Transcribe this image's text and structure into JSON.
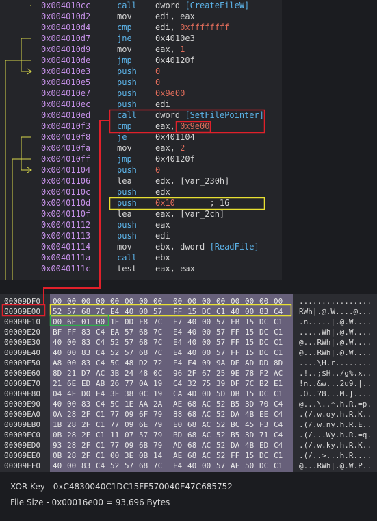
{
  "disassembly": [
    {
      "addr": "0x004010cc",
      "mn": "call",
      "mk": "call",
      "ops": [
        {
          "t": "dword ",
          "c": "br"
        },
        {
          "t": "[CreateFileW]",
          "c": "api"
        }
      ]
    },
    {
      "addr": "0x004010d2",
      "mn": "mov",
      "mk": "plain",
      "ops": [
        {
          "t": "edi, eax",
          "c": "br"
        }
      ]
    },
    {
      "addr": "0x004010d4",
      "mn": "cmp",
      "mk": "flow",
      "ops": [
        {
          "t": "edi, ",
          "c": "br"
        },
        {
          "t": "0xffffffff",
          "c": "num"
        }
      ]
    },
    {
      "addr": "0x004010d7",
      "mn": "jne",
      "mk": "flow",
      "ops": [
        {
          "t": "0x4010e3",
          "c": "br"
        }
      ]
    },
    {
      "addr": "0x004010d9",
      "mn": "mov",
      "mk": "plain",
      "ops": [
        {
          "t": "eax, ",
          "c": "br"
        },
        {
          "t": "1",
          "c": "num"
        }
      ]
    },
    {
      "addr": "0x004010de",
      "mn": "jmp",
      "mk": "flow",
      "ops": [
        {
          "t": "0x40120f",
          "c": "br"
        }
      ]
    },
    {
      "addr": "0x004010e3",
      "mn": "push",
      "mk": "flow",
      "ops": [
        {
          "t": "0",
          "c": "num"
        }
      ]
    },
    {
      "addr": "0x004010e5",
      "mn": "push",
      "mk": "flow",
      "ops": [
        {
          "t": "0",
          "c": "num"
        }
      ]
    },
    {
      "addr": "0x004010e7",
      "mn": "push",
      "mk": "flow",
      "ops": [
        {
          "t": "0x9e00",
          "c": "num"
        }
      ]
    },
    {
      "addr": "0x004010ec",
      "mn": "push",
      "mk": "flow",
      "ops": [
        {
          "t": "edi",
          "c": "br"
        }
      ]
    },
    {
      "addr": "0x004010ed",
      "mn": "call",
      "mk": "call",
      "ops": [
        {
          "t": "dword ",
          "c": "br"
        },
        {
          "t": "[SetFilePointer]",
          "c": "api"
        }
      ]
    },
    {
      "addr": "0x004010f3",
      "mn": "cmp",
      "mk": "flow",
      "ops": [
        {
          "t": "eax, ",
          "c": "br"
        },
        {
          "t": "0x9e00",
          "c": "num"
        }
      ]
    },
    {
      "addr": "0x004010f8",
      "mn": "je",
      "mk": "flow",
      "ops": [
        {
          "t": "0x401104",
          "c": "br"
        }
      ]
    },
    {
      "addr": "0x004010fa",
      "mn": "mov",
      "mk": "plain",
      "ops": [
        {
          "t": "eax, ",
          "c": "br"
        },
        {
          "t": "2",
          "c": "num"
        }
      ]
    },
    {
      "addr": "0x004010ff",
      "mn": "jmp",
      "mk": "flow",
      "ops": [
        {
          "t": "0x40120f",
          "c": "br"
        }
      ]
    },
    {
      "addr": "0x00401104",
      "mn": "push",
      "mk": "flow",
      "ops": [
        {
          "t": "0",
          "c": "num"
        }
      ]
    },
    {
      "addr": "0x00401106",
      "mn": "lea",
      "mk": "plain",
      "ops": [
        {
          "t": "edx, [var_230h]",
          "c": "br"
        }
      ]
    },
    {
      "addr": "0x0040110c",
      "mn": "push",
      "mk": "flow",
      "ops": [
        {
          "t": "edx",
          "c": "br"
        }
      ]
    },
    {
      "addr": "0x0040110d",
      "mn": "push",
      "mk": "flow",
      "ops": [
        {
          "t": "0x10",
          "c": "num"
        },
        {
          "t": "       ; 16",
          "c": "cmt"
        }
      ]
    },
    {
      "addr": "0x0040110f",
      "mn": "lea",
      "mk": "plain",
      "ops": [
        {
          "t": "eax, [var_2ch]",
          "c": "br"
        }
      ]
    },
    {
      "addr": "0x00401112",
      "mn": "push",
      "mk": "flow",
      "ops": [
        {
          "t": "eax",
          "c": "br"
        }
      ]
    },
    {
      "addr": "0x00401113",
      "mn": "push",
      "mk": "flow",
      "ops": [
        {
          "t": "edi",
          "c": "br"
        }
      ]
    },
    {
      "addr": "0x00401114",
      "mn": "mov",
      "mk": "plain",
      "ops": [
        {
          "t": "ebx, dword ",
          "c": "br"
        },
        {
          "t": "[ReadFile]",
          "c": "api"
        }
      ]
    },
    {
      "addr": "0x0040111a",
      "mn": "call",
      "mk": "call",
      "ops": [
        {
          "t": "ebx",
          "c": "br"
        }
      ]
    },
    {
      "addr": "0x0040111c",
      "mn": "test",
      "mk": "plain",
      "ops": [
        {
          "t": "eax, eax",
          "c": "br"
        }
      ]
    }
  ],
  "hexdump": [
    {
      "off": "00009DF0",
      "bytes": [
        "00",
        "00",
        "00",
        "00",
        "00",
        "00",
        "00",
        "00",
        "00",
        "00",
        "00",
        "00",
        "00",
        "00",
        "00",
        "00"
      ],
      "ascii": "................"
    },
    {
      "off": "00009E00",
      "bytes": [
        "52",
        "57",
        "68",
        "7C",
        "E4",
        "40",
        "00",
        "57",
        "FF",
        "15",
        "DC",
        "C1",
        "40",
        "00",
        "83",
        "C4"
      ],
      "ascii": "RWh|.@.W....@..."
    },
    {
      "off": "00009E10",
      "bytes": [
        "00",
        "6E",
        "01",
        "00",
        "1F",
        "0D",
        "F8",
        "7C",
        "E7",
        "40",
        "00",
        "57",
        "FB",
        "15",
        "DC",
        "C1"
      ],
      "ascii": ".n.....|.@.W...."
    },
    {
      "off": "00009E20",
      "bytes": [
        "BF",
        "FF",
        "83",
        "C4",
        "EA",
        "57",
        "68",
        "7C",
        "E4",
        "40",
        "00",
        "57",
        "FF",
        "15",
        "DC",
        "C1"
      ],
      "ascii": ".....Wh|.@.W...."
    },
    {
      "off": "00009E30",
      "bytes": [
        "40",
        "00",
        "83",
        "C4",
        "52",
        "57",
        "68",
        "7C",
        "E4",
        "40",
        "00",
        "57",
        "FF",
        "15",
        "DC",
        "C1"
      ],
      "ascii": "@...RWh|.@.W...."
    },
    {
      "off": "00009E40",
      "bytes": [
        "40",
        "00",
        "83",
        "C4",
        "52",
        "57",
        "68",
        "7C",
        "E4",
        "40",
        "00",
        "57",
        "FF",
        "15",
        "DC",
        "C1"
      ],
      "ascii": "@...RWh|.@.W...."
    },
    {
      "off": "00009E50",
      "bytes": [
        "A8",
        "00",
        "83",
        "C4",
        "5C",
        "48",
        "D2",
        "72",
        "E4",
        "F4",
        "09",
        "9A",
        "DE",
        "AD",
        "DD",
        "8D"
      ],
      "ascii": "....\\H.r........"
    },
    {
      "off": "00009E60",
      "bytes": [
        "8D",
        "21",
        "D7",
        "AC",
        "3B",
        "24",
        "48",
        "0C",
        "96",
        "2F",
        "67",
        "25",
        "9E",
        "78",
        "F2",
        "AC"
      ],
      "ascii": ".!..;$H../g%.x.."
    },
    {
      "off": "00009E70",
      "bytes": [
        "21",
        "6E",
        "ED",
        "AB",
        "26",
        "77",
        "0A",
        "19",
        "C4",
        "32",
        "75",
        "39",
        "DF",
        "7C",
        "B2",
        "E1"
      ],
      "ascii": "!n..&w...2u9.|.."
    },
    {
      "off": "00009E80",
      "bytes": [
        "04",
        "4F",
        "D0",
        "E4",
        "3F",
        "38",
        "0C",
        "19",
        "CA",
        "4D",
        "0D",
        "5D",
        "DB",
        "15",
        "DC",
        "C1"
      ],
      "ascii": ".O..?8...M.]...."
    },
    {
      "off": "00009E90",
      "bytes": [
        "40",
        "00",
        "83",
        "C4",
        "5C",
        "1E",
        "AA",
        "2A",
        "AE",
        "68",
        "AC",
        "52",
        "B5",
        "3D",
        "70",
        "C4"
      ],
      "ascii": "@...\\..*.h.R.=p."
    },
    {
      "off": "00009EA0",
      "bytes": [
        "0A",
        "28",
        "2F",
        "C1",
        "77",
        "09",
        "6F",
        "79",
        "88",
        "68",
        "AC",
        "52",
        "DA",
        "4B",
        "EE",
        "C4"
      ],
      "ascii": ".(/.w.oy.h.R.K.."
    },
    {
      "off": "00009EB0",
      "bytes": [
        "1B",
        "28",
        "2F",
        "C1",
        "77",
        "09",
        "6E",
        "79",
        "E0",
        "68",
        "AC",
        "52",
        "BC",
        "45",
        "F3",
        "C4"
      ],
      "ascii": ".(/.w.ny.h.R.E.."
    },
    {
      "off": "00009EC0",
      "bytes": [
        "0B",
        "28",
        "2F",
        "C1",
        "11",
        "07",
        "57",
        "79",
        "BD",
        "68",
        "AC",
        "52",
        "B5",
        "3D",
        "71",
        "C4"
      ],
      "ascii": ".(/...Wy.h.R.=q."
    },
    {
      "off": "00009ED0",
      "bytes": [
        "93",
        "28",
        "2F",
        "C1",
        "77",
        "09",
        "6B",
        "79",
        "AD",
        "68",
        "AC",
        "52",
        "DA",
        "4B",
        "ED",
        "C4"
      ],
      "ascii": ".(/.w.ky.h.R.K.."
    },
    {
      "off": "00009EE0",
      "bytes": [
        "0B",
        "28",
        "2F",
        "C1",
        "00",
        "3E",
        "0B",
        "14",
        "AE",
        "68",
        "AC",
        "52",
        "FF",
        "15",
        "DC",
        "C1"
      ],
      "ascii": ".(/..>...h.R...."
    },
    {
      "off": "00009EF0",
      "bytes": [
        "40",
        "00",
        "83",
        "C4",
        "52",
        "57",
        "68",
        "7C",
        "E4",
        "40",
        "00",
        "57",
        "AF",
        "50",
        "DC",
        "C1"
      ],
      "ascii": "@...RWh|.@.W.P.."
    }
  ],
  "info": {
    "xor_key": "XOR Key - 0xC4830040C1DC15FF570040E47C685752",
    "file_size": "File Size - 0x00016e00 = 93,696 Bytes"
  },
  "colors": {
    "address": "#c792ea",
    "flow_mnemonic": "#5cb3e8",
    "number": "#e06c5a",
    "highlight_red": "#e0202a",
    "highlight_yellow": "#e8e032",
    "highlight_green": "#2fae4a",
    "arrow": "#d8d84a"
  }
}
